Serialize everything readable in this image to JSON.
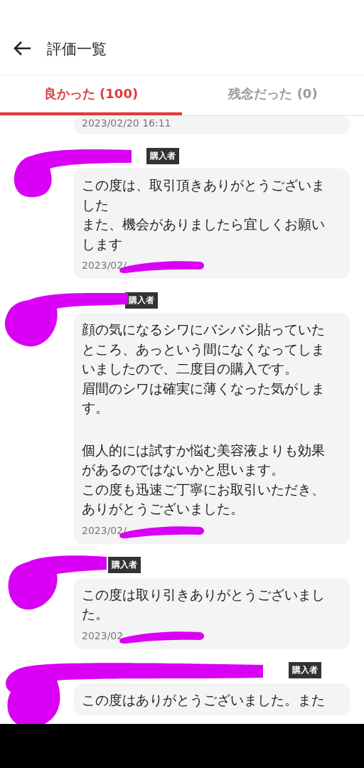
{
  "header": {
    "title": "評価一覧"
  },
  "tabs": [
    {
      "label": "良かった (100)",
      "selected": true
    },
    {
      "label": "残念だった (0)",
      "selected": false
    }
  ],
  "top_card": {
    "date": "2023/02/20 16:11"
  },
  "reviews": [
    {
      "badge": "購入者",
      "paragraphs": [
        [
          "この度は、取引頂きありがとうございました",
          "また、機会がありましたら宜しくお願いします"
        ]
      ],
      "date": "2023/02/"
    },
    {
      "badge": "購入者",
      "paragraphs": [
        [
          "顔の気になるシワにバシバシ貼っていたところ、あっという間になくなってしまいましたので、二度目の購入です。",
          "眉間のシワは確実に薄くなった気がします。"
        ],
        [
          "個人的には試すか悩む美容液よりも効果があるのではないかと思います。",
          "この度も迅速ご丁寧にお取引いただき、ありがとうございました。"
        ]
      ],
      "date": "2023/02/"
    },
    {
      "badge": "購入者",
      "paragraphs": [
        [
          "この度は取り引きありがとうございました。"
        ]
      ],
      "date": "2023/02"
    },
    {
      "badge": "購入者",
      "paragraphs": [
        [
          "この度はありがとうございました。また"
        ]
      ]
    }
  ]
}
